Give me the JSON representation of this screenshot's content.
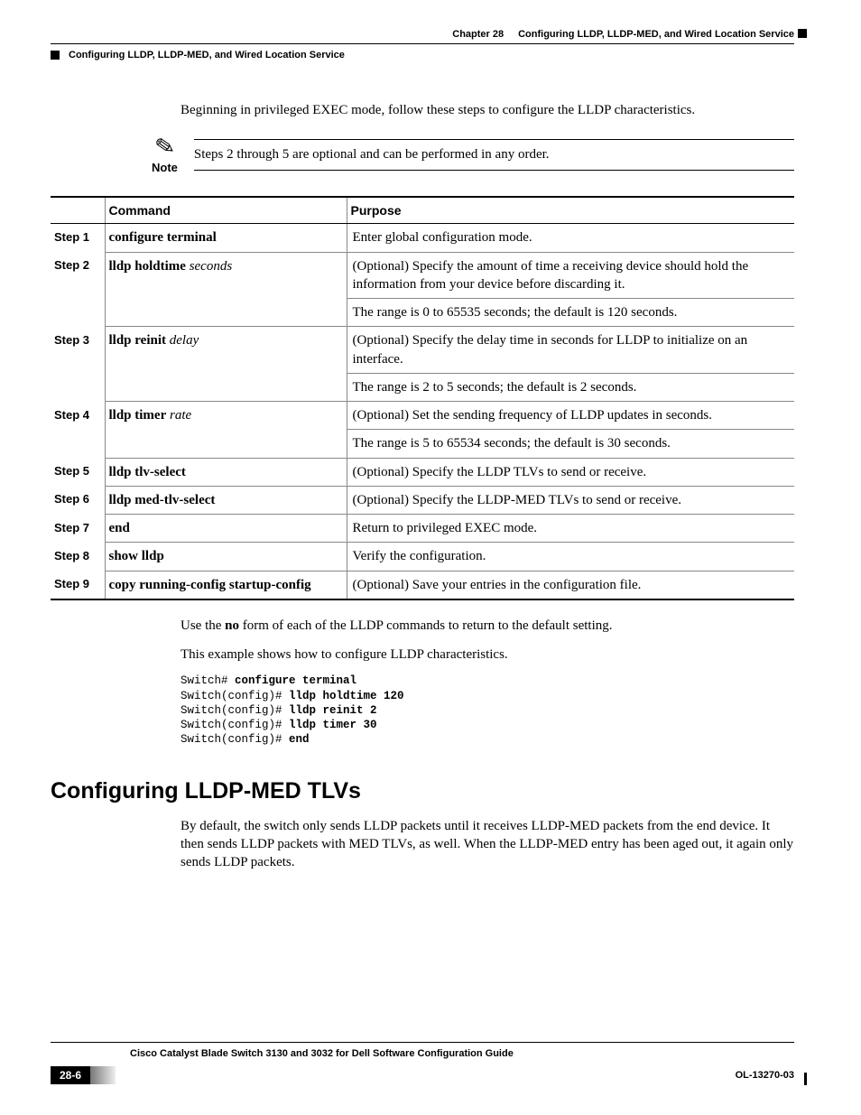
{
  "header": {
    "chapter": "Chapter 28",
    "chapterTitle": "Configuring LLDP, LLDP-MED, and Wired Location Service",
    "section": "Configuring LLDP, LLDP-MED, and Wired Location Service"
  },
  "intro": "Beginning in privileged EXEC mode, follow these steps to configure the LLDP characteristics.",
  "note": {
    "label": "Note",
    "text": "Steps 2 through 5 are optional and can be performed in any order."
  },
  "table": {
    "headers": {
      "command": "Command",
      "purpose": "Purpose"
    },
    "rows": [
      {
        "step": "Step 1",
        "cmd_bold": "configure terminal",
        "cmd_italic": "",
        "purposes": [
          "Enter global configuration mode."
        ]
      },
      {
        "step": "Step 2",
        "cmd_bold": "lldp holdtime",
        "cmd_italic": "seconds",
        "purposes": [
          "(Optional) Specify the amount of time a receiving device should hold the information from your device before discarding it.",
          "The range is 0 to 65535 seconds; the default is 120 seconds."
        ]
      },
      {
        "step": "Step 3",
        "cmd_bold": "lldp reinit",
        "cmd_italic": "delay",
        "purposes": [
          "(Optional) Specify the delay time in seconds for LLDP to initialize on an interface.",
          "The range is 2 to 5 seconds; the default is 2 seconds."
        ]
      },
      {
        "step": "Step 4",
        "cmd_bold": "lldp timer",
        "cmd_italic": "rate",
        "purposes": [
          "(Optional) Set the sending frequency of LLDP updates in seconds.",
          "The range is 5 to 65534 seconds; the default is 30 seconds."
        ]
      },
      {
        "step": "Step 5",
        "cmd_bold": "lldp tlv-select",
        "cmd_italic": "",
        "purposes": [
          "(Optional) Specify the LLDP TLVs to send or receive."
        ]
      },
      {
        "step": "Step 6",
        "cmd_bold": "lldp med-tlv-select",
        "cmd_italic": "",
        "purposes": [
          "(Optional) Specify the LLDP-MED TLVs to send or receive."
        ]
      },
      {
        "step": "Step 7",
        "cmd_bold": "end",
        "cmd_italic": "",
        "purposes": [
          "Return to privileged EXEC mode."
        ]
      },
      {
        "step": "Step 8",
        "cmd_bold": "show lldp",
        "cmd_italic": "",
        "purposes": [
          "Verify the configuration."
        ]
      },
      {
        "step": "Step 9",
        "cmd_bold": "copy running-config startup-config",
        "cmd_italic": "",
        "purposes": [
          "(Optional) Save your entries in the configuration file."
        ]
      }
    ]
  },
  "after": {
    "p1a": "Use the ",
    "p1b": "no",
    "p1c": " form of each of the LLDP commands to return to the default setting.",
    "p2": "This example shows how to configure LLDP characteristics."
  },
  "code": {
    "l1a": "Switch# ",
    "l1b": "configure terminal",
    "l2a": "Switch(config)# ",
    "l2b": "lldp holdtime 120",
    "l3a": "Switch(config)# ",
    "l3b": "lldp reinit 2",
    "l4a": "Switch(config)# ",
    "l4b": "lldp timer 30",
    "l5a": "Switch(config)# ",
    "l5b": "end"
  },
  "h2": "Configuring LLDP-MED TLVs",
  "body2": "By default, the switch only sends LLDP packets until it receives LLDP-MED packets from the end device. It then sends LLDP packets with MED TLVs, as well. When the LLDP-MED entry has been aged out, it again only sends LLDP packets.",
  "footer": {
    "guide": "Cisco Catalyst Blade Switch 3130 and 3032 for Dell Software Configuration Guide",
    "page": "28-6",
    "ol": "OL-13270-03"
  }
}
